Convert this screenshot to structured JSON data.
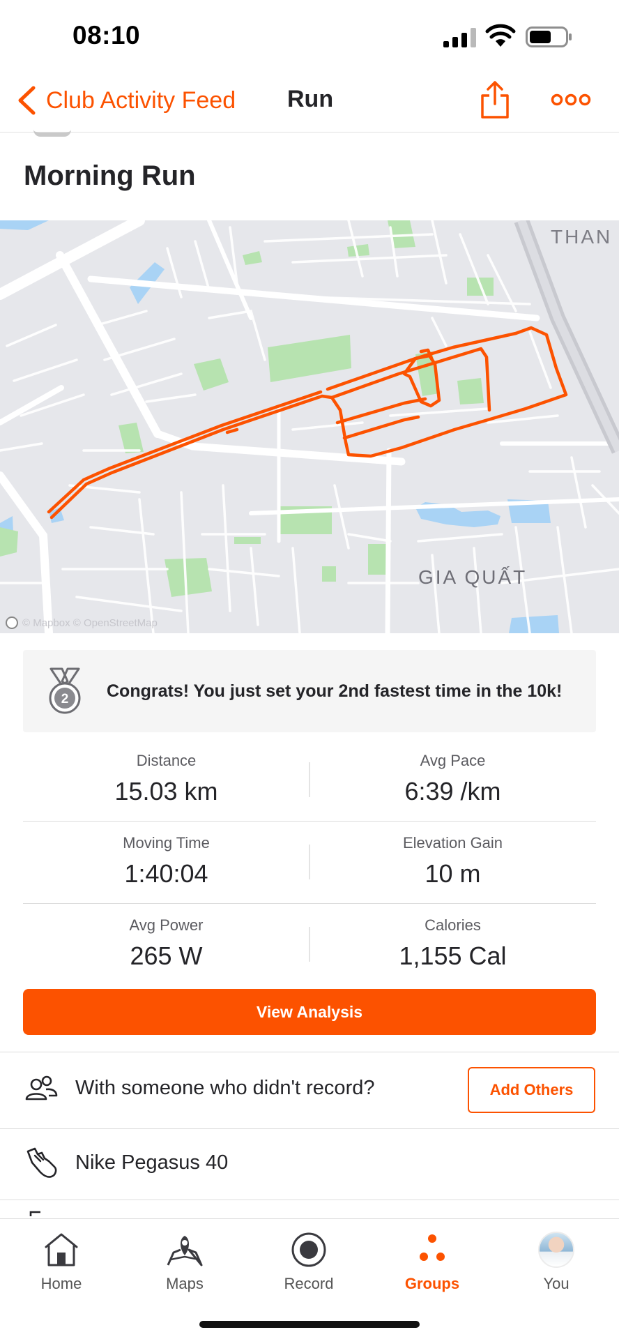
{
  "status_bar": {
    "time": "08:10"
  },
  "nav": {
    "back_label": "Club Activity Feed",
    "title": "Run"
  },
  "activity": {
    "title": "Morning Run"
  },
  "map": {
    "labels": {
      "thanh": "THAN",
      "gia_quat": "GIA QUẤT"
    },
    "attribution": "© Mapbox © OpenStreetMap"
  },
  "achievement": {
    "text": "Congrats! You just set your 2nd fastest time in the 10k!"
  },
  "stats": [
    {
      "label": "Distance",
      "value": "15.03 km"
    },
    {
      "label": "Avg Pace",
      "value": "6:39 /km"
    },
    {
      "label": "Moving Time",
      "value": "1:40:04"
    },
    {
      "label": "Elevation Gain",
      "value": "10 m"
    },
    {
      "label": "Avg Power",
      "value": "265 W"
    },
    {
      "label": "Calories",
      "value": "1,155 Cal"
    }
  ],
  "buttons": {
    "view_analysis": "View Analysis",
    "add_others": "Add Others"
  },
  "rows": {
    "with_someone": "With someone who didn't record?",
    "gear": "Nike Pegasus 40"
  },
  "tabbar": {
    "tabs": [
      {
        "label": "Home"
      },
      {
        "label": "Maps"
      },
      {
        "label": "Record"
      },
      {
        "label": "Groups",
        "active": true
      },
      {
        "label": "You"
      }
    ]
  },
  "colors": {
    "accent": "#fc5200",
    "route": "#fc5200",
    "park": "#b7e3b0",
    "water": "#a9d3f5",
    "map_bg": "#e6e7eb"
  }
}
